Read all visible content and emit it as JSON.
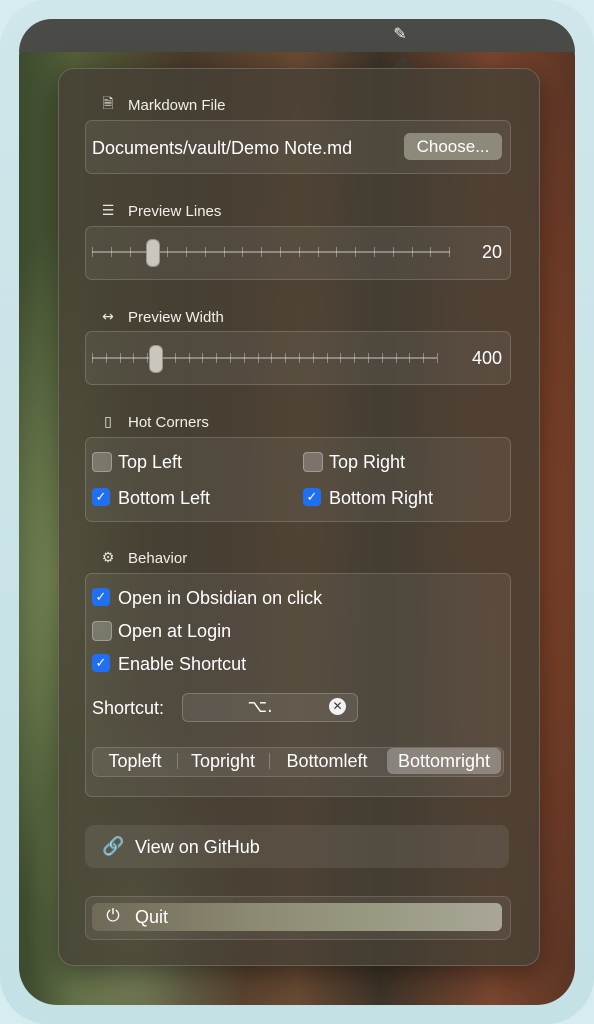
{
  "menubar": {
    "icon": "pencil-icon",
    "glyph": "✎"
  },
  "markdown_file": {
    "title": "Markdown File",
    "icon": "document-icon",
    "glyph": "🗎",
    "path": "Documents/vault/Demo Note.md",
    "choose_label": "Choose..."
  },
  "preview_lines": {
    "title": "Preview Lines",
    "icon": "text-lines-icon",
    "glyph": "☰",
    "value": "20"
  },
  "preview_width": {
    "title": "Preview Width",
    "icon": "horizontal-arrows-icon",
    "glyph": "↔",
    "value": "400"
  },
  "hot_corners": {
    "title": "Hot Corners",
    "icon": "phone-icon",
    "glyph": "▯",
    "items": [
      {
        "label": "Top Left",
        "checked": false
      },
      {
        "label": "Top Right",
        "checked": false
      },
      {
        "label": "Bottom Left",
        "checked": true
      },
      {
        "label": "Bottom Right",
        "checked": true
      }
    ]
  },
  "behavior": {
    "title": "Behavior",
    "icon": "gear-icon",
    "glyph": "⚙",
    "options": [
      {
        "label": "Open in Obsidian on click",
        "checked": true
      },
      {
        "label": "Open at Login",
        "checked": false
      },
      {
        "label": "Enable Shortcut",
        "checked": true
      }
    ],
    "shortcut_label": "Shortcut:",
    "shortcut_keys": "⌥.",
    "segments": [
      "Topleft",
      "Topright",
      "Bottomleft",
      "Bottomright"
    ],
    "active_segment": "Bottomright"
  },
  "github": {
    "label": "View on GitHub",
    "icon": "link-icon",
    "glyph": "🔗"
  },
  "quit": {
    "label": "Quit",
    "icon": "power-icon",
    "glyph": "⏻"
  },
  "colors": {
    "accent": "#1f6ff2",
    "panel": "#46403a"
  }
}
